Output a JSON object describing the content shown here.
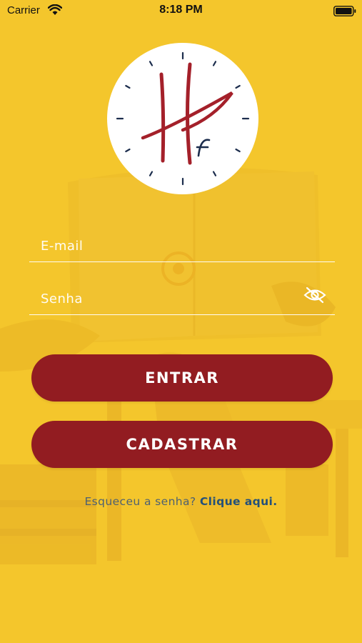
{
  "status_bar": {
    "carrier": "Carrier",
    "time": "8:18 PM"
  },
  "logo": {
    "text_big": "H",
    "text_small": "f"
  },
  "login_form": {
    "email_placeholder": "E-mail",
    "password_placeholder": "Senha",
    "login_label": "ENTRAR",
    "register_label": "CADASTRAR"
  },
  "forgot": {
    "text": "Esqueceu a senha?",
    "link": "Clique aqui."
  },
  "colors": {
    "background": "#f4c62c",
    "button": "#921c21",
    "link": "#23507a",
    "logo_red": "#a4202a",
    "logo_navy": "#1c2d4d"
  },
  "icons": [
    "wifi-icon",
    "battery-icon",
    "clock-logo-icon",
    "eye-off-icon"
  ]
}
